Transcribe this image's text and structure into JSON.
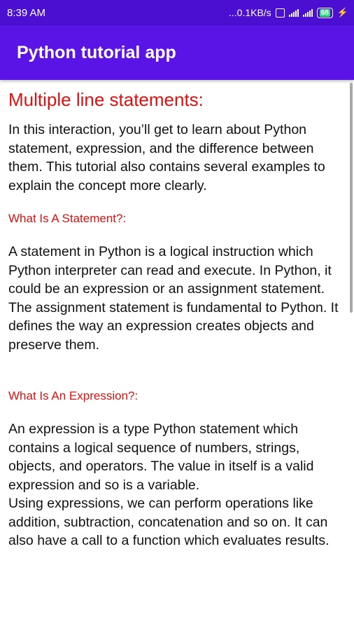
{
  "status_bar": {
    "time": "8:39 AM",
    "speed": "...0.1KB/s",
    "battery": "68"
  },
  "app_bar": {
    "title": "Python tutorial app"
  },
  "content": {
    "heading": "Multiple line statements:",
    "intro": "In this interaction, you’ll get to learn about Python statement, expression, and the difference between them. This tutorial also contains several examples to explain the concept more clearly.",
    "sections": [
      {
        "title": "What Is A Statement?:",
        "paragraphs": [
          "A statement in Python is a logical instruction which Python interpreter can read and execute. In Python, it could be an expression or an assignment statement.",
          "The assignment statement is fundamental to Python. It defines the way an expression creates objects and preserve them."
        ]
      },
      {
        "title": "What Is An Expression?:",
        "paragraphs": [
          "An expression is a type Python statement which contains a logical sequence of numbers, strings, objects, and operators. The value in itself is a valid expression and so is a variable.",
          "Using expressions, we can perform operations like addition, subtraction, concatenation and so on. It can also have a call to a function which evaluates results."
        ]
      }
    ]
  }
}
